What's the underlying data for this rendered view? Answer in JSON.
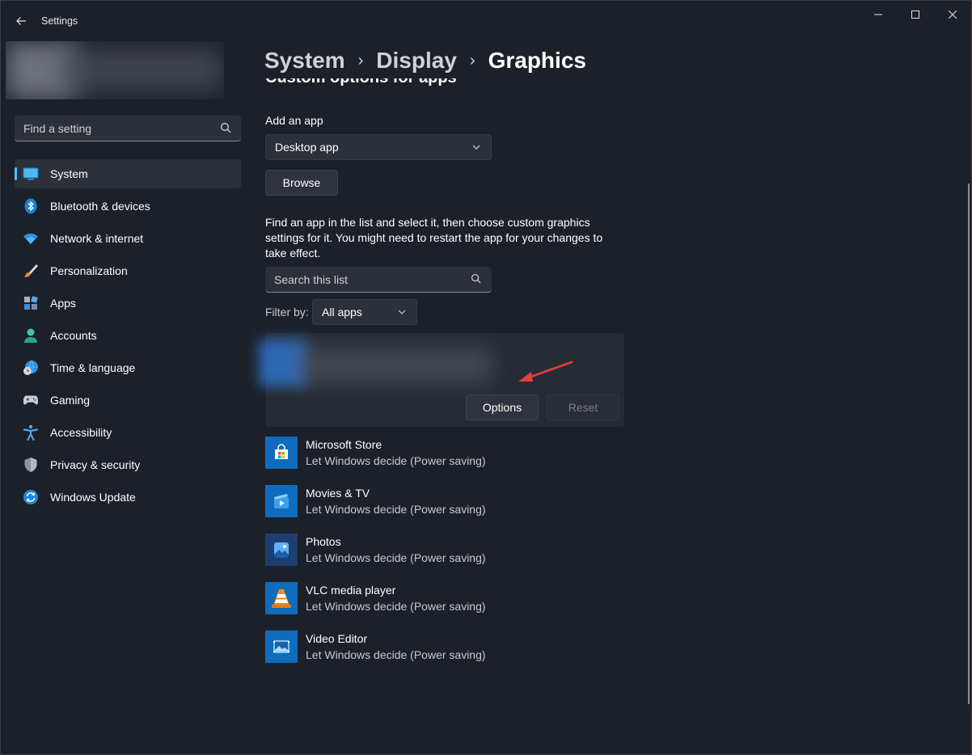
{
  "window": {
    "title": "Settings"
  },
  "search": {
    "placeholder": "Find a setting"
  },
  "nav": {
    "items": [
      {
        "label": "System",
        "icon": "monitor-icon"
      },
      {
        "label": "Bluetooth & devices",
        "icon": "bluetooth-icon"
      },
      {
        "label": "Network & internet",
        "icon": "wifi-icon"
      },
      {
        "label": "Personalization",
        "icon": "brush-icon"
      },
      {
        "label": "Apps",
        "icon": "apps-icon"
      },
      {
        "label": "Accounts",
        "icon": "person-icon"
      },
      {
        "label": "Time & language",
        "icon": "globe-clock-icon"
      },
      {
        "label": "Gaming",
        "icon": "gamepad-icon"
      },
      {
        "label": "Accessibility",
        "icon": "accessibility-icon"
      },
      {
        "label": "Privacy & security",
        "icon": "shield-icon"
      },
      {
        "label": "Windows Update",
        "icon": "update-icon"
      }
    ],
    "active_index": 0
  },
  "breadcrumb": {
    "items": [
      "System",
      "Display",
      "Graphics"
    ]
  },
  "main": {
    "section_title_peek": "Custom options for apps",
    "add_app_label": "Add an app",
    "app_type_dropdown": "Desktop app",
    "browse_button": "Browse",
    "description": "Find an app in the list and select it, then choose custom graphics settings for it. You might need to restart the app for your changes to take effect.",
    "list_search_placeholder": "Search this list",
    "filter_label": "Filter by:",
    "filter_value": "All apps",
    "selected_card": {
      "options_button": "Options",
      "reset_button": "Reset"
    },
    "apps": [
      {
        "name": "Microsoft Store",
        "setting": "Let Windows decide (Power saving)",
        "icon": "store-icon"
      },
      {
        "name": "Movies & TV",
        "setting": "Let Windows decide (Power saving)",
        "icon": "movies-icon"
      },
      {
        "name": "Photos",
        "setting": "Let Windows decide (Power saving)",
        "icon": "photos-icon"
      },
      {
        "name": "VLC media player",
        "setting": "Let Windows decide (Power saving)",
        "icon": "vlc-icon"
      },
      {
        "name": "Video Editor",
        "setting": "Let Windows decide (Power saving)",
        "icon": "video-editor-icon"
      }
    ]
  },
  "colors": {
    "accent": "#4cc2ff",
    "arrow": "#e2403a",
    "app_tile": "#0f6cbd"
  }
}
